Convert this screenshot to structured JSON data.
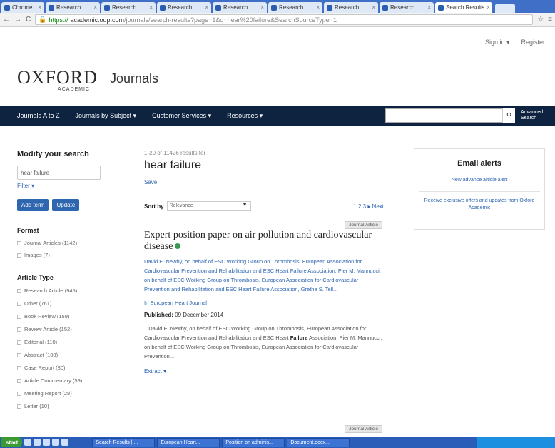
{
  "browser": {
    "tabs": [
      "Chrome",
      "Research",
      "Research",
      "Research",
      "Research",
      "Research",
      "Research",
      "Research",
      "Research",
      "Search Results"
    ],
    "active_tab": 9,
    "url_scheme": "https://",
    "url_host": "academic.oup.com",
    "url_path": "/journals/search-results?page=1&q=hear%20failure&SearchSourceType=1"
  },
  "account": {
    "sign_in": "Sign in ▾",
    "register": "Register"
  },
  "site": {
    "logo_main": "OXFORD",
    "logo_sub": "ACADEMIC",
    "section": "Journals"
  },
  "nav": {
    "items": [
      "Journals A to Z",
      "Journals by Subject ▾",
      "Customer Services ▾",
      "Resources ▾"
    ],
    "search_placeholder": "",
    "advanced": "Advanced Search"
  },
  "sidebar": {
    "title": "Modify your search",
    "query_value": "hear failure",
    "filter": "Filter ▾",
    "add_term": "Add term",
    "update": "Update",
    "format_heading": "Format",
    "format": [
      "Journal Articles (1142)",
      "Images (7)"
    ],
    "type_heading": "Article Type",
    "types": [
      "Research Article (945)",
      "Other (761)",
      "Book Review (159)",
      "Review Article (152)",
      "Editorial (110)",
      "Abstract (108)",
      "Case Report (80)",
      "Article Commentary (59)",
      "Meeting Report (28)",
      "Letter (10)"
    ]
  },
  "results": {
    "count": "1-20 of 11426 results for",
    "query": "hear failure",
    "save": "Save",
    "sort_label": "Sort by",
    "sort_value": "Relevance",
    "pager": "1  2  3  ▸  Next",
    "items": [
      {
        "tag": "Journal Article",
        "title": "Expert position paper on air pollution and cardiovascular disease",
        "authors": "David E. Newby, on behalf of ESC Working Group on Thrombosis, European Association for Cardiovascular Prevention and Rehabilitation and ESC Heart Failure Association, Pier M. Mannucci, on behalf of ESC Working Group on Thrombosis, European Association for Cardiovascular Prevention and Rehabilitation and ESC Heart Failure Association, Grethe S. Tell...",
        "journal": "In European Heart Journal",
        "published_label": "Published:",
        "published_date": "09 December 2014",
        "snippet_a": "...David E. Newby, on behalf of ESC Working Group on Thrombosis, European Association for Cardiovascular Prevention and Rehabilitation and ESC Heart ",
        "snippet_bold": "Failure",
        "snippet_b": " Association, Pier M. Mannucci, on behalf of ESC Working Group on Thrombosis, European Association for Cardiovascular Prevention...",
        "extract": "Extract ▾"
      },
      {
        "tag": "Journal Article"
      }
    ]
  },
  "alerts": {
    "title": "Email alerts",
    "link1": "New advance article alert",
    "link2": "Receive exclusive offers and updates from Oxford Academic"
  },
  "taskbar": {
    "start": "start",
    "tasks": [
      "Search Results | ...",
      "European Heart...",
      "Position on adminis...",
      "Document.docx..."
    ]
  },
  "colors": {
    "nav_bg": "#0d2340",
    "link": "#2f66b0",
    "button": "#2f66b0",
    "oa_icon": "#3a9a52"
  }
}
